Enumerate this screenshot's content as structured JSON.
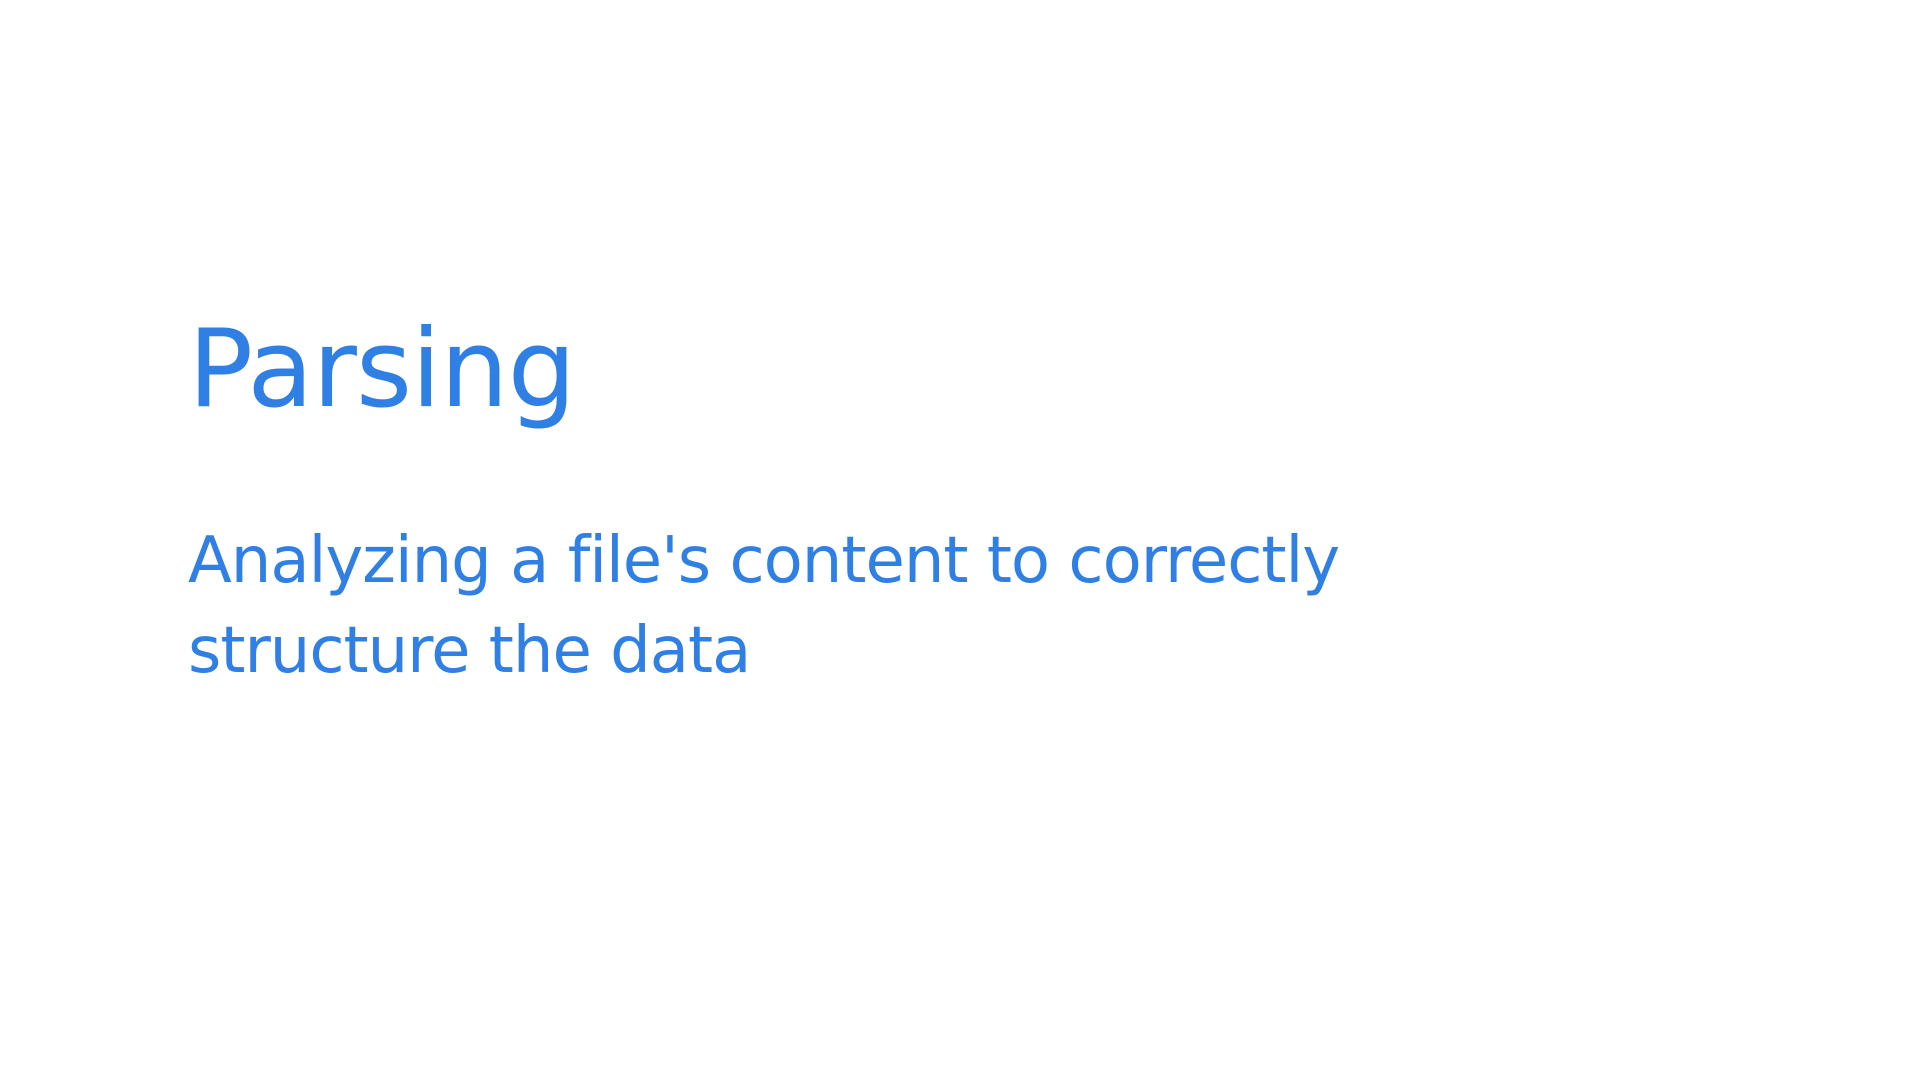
{
  "slide": {
    "title": "Parsing",
    "subtitle": "Analyzing a file's content to correctly structure the data",
    "text_color": "#2f7fe4",
    "background_color": "#ffffff"
  }
}
